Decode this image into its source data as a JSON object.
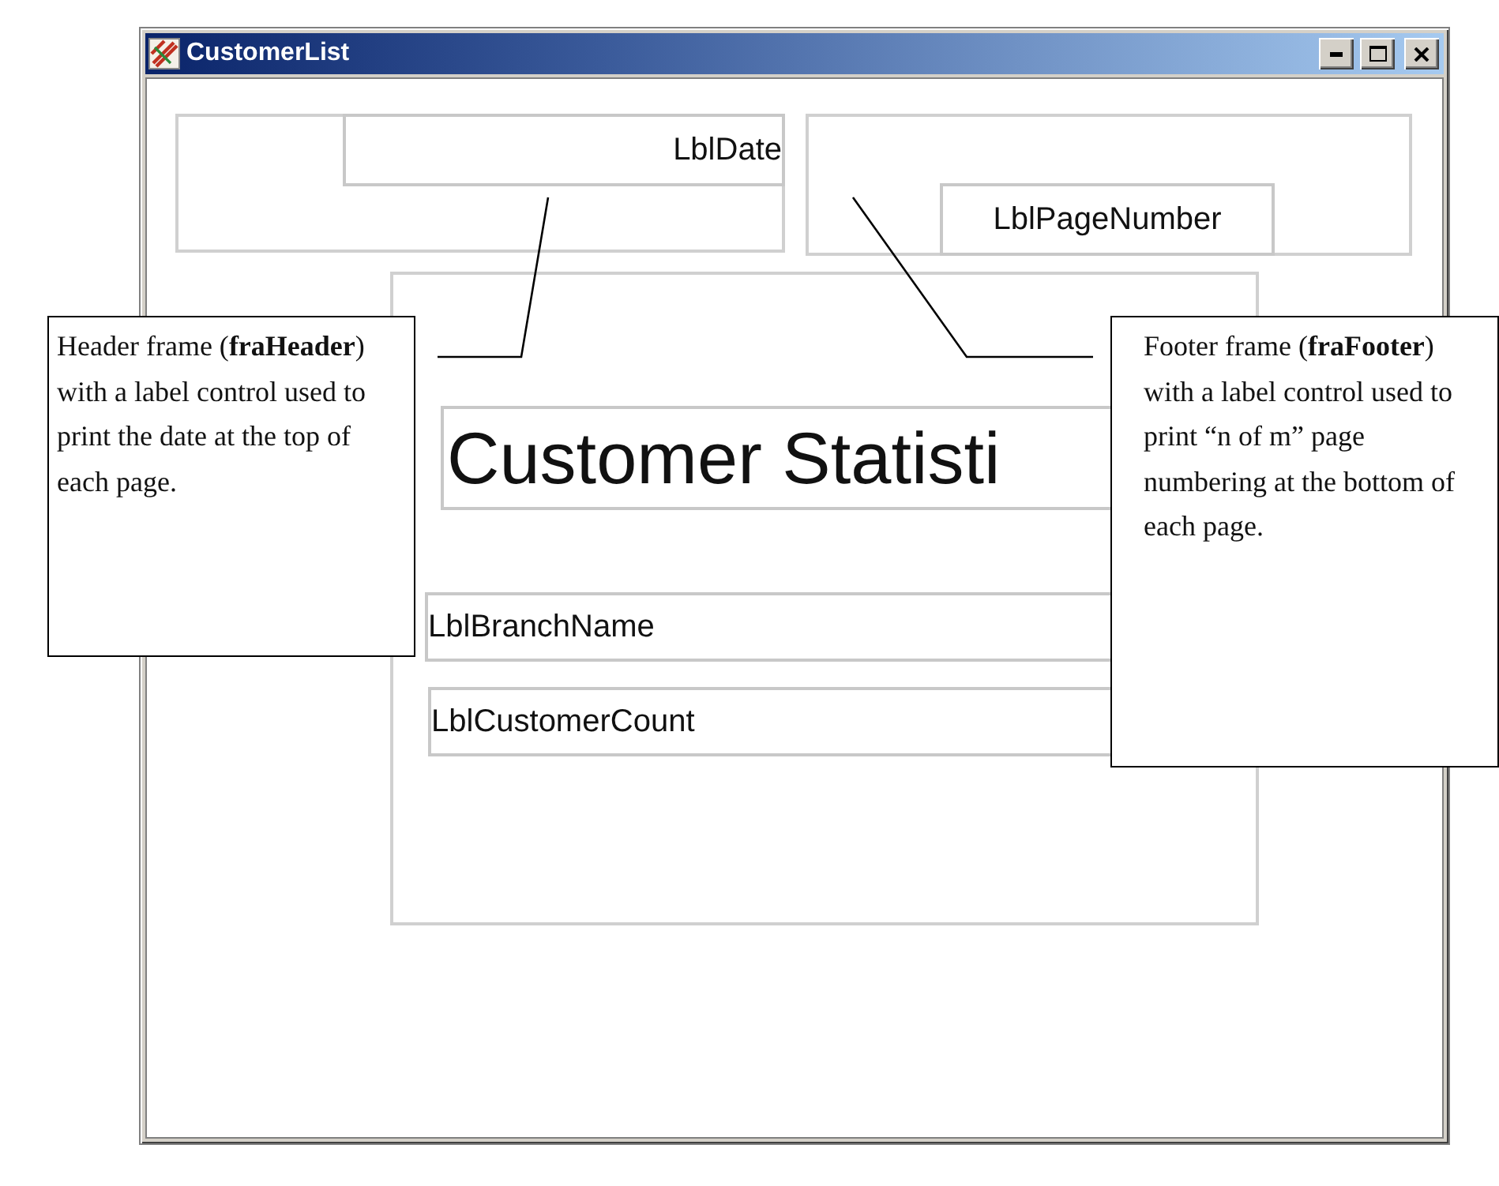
{
  "window": {
    "title": "CustomerList"
  },
  "form": {
    "header_frame": {
      "label": "LblDate"
    },
    "footer_frame": {
      "label": "LblPageNumber"
    },
    "detail_frame": {
      "labels": [
        {
          "kind": "title",
          "text": "Customer Statisti"
        },
        {
          "kind": "field",
          "text": "LblBranchName"
        },
        {
          "kind": "field",
          "text": "LblCustomerCount"
        }
      ]
    }
  },
  "callouts": [
    {
      "text": "Header frame (**fraHeader**) with a label control used to print the date at the top of each page."
    },
    {
      "text": "Footer frame (**fraFooter**) with a label control used to print “n of m” page numbering at the bottom of each page."
    }
  ]
}
